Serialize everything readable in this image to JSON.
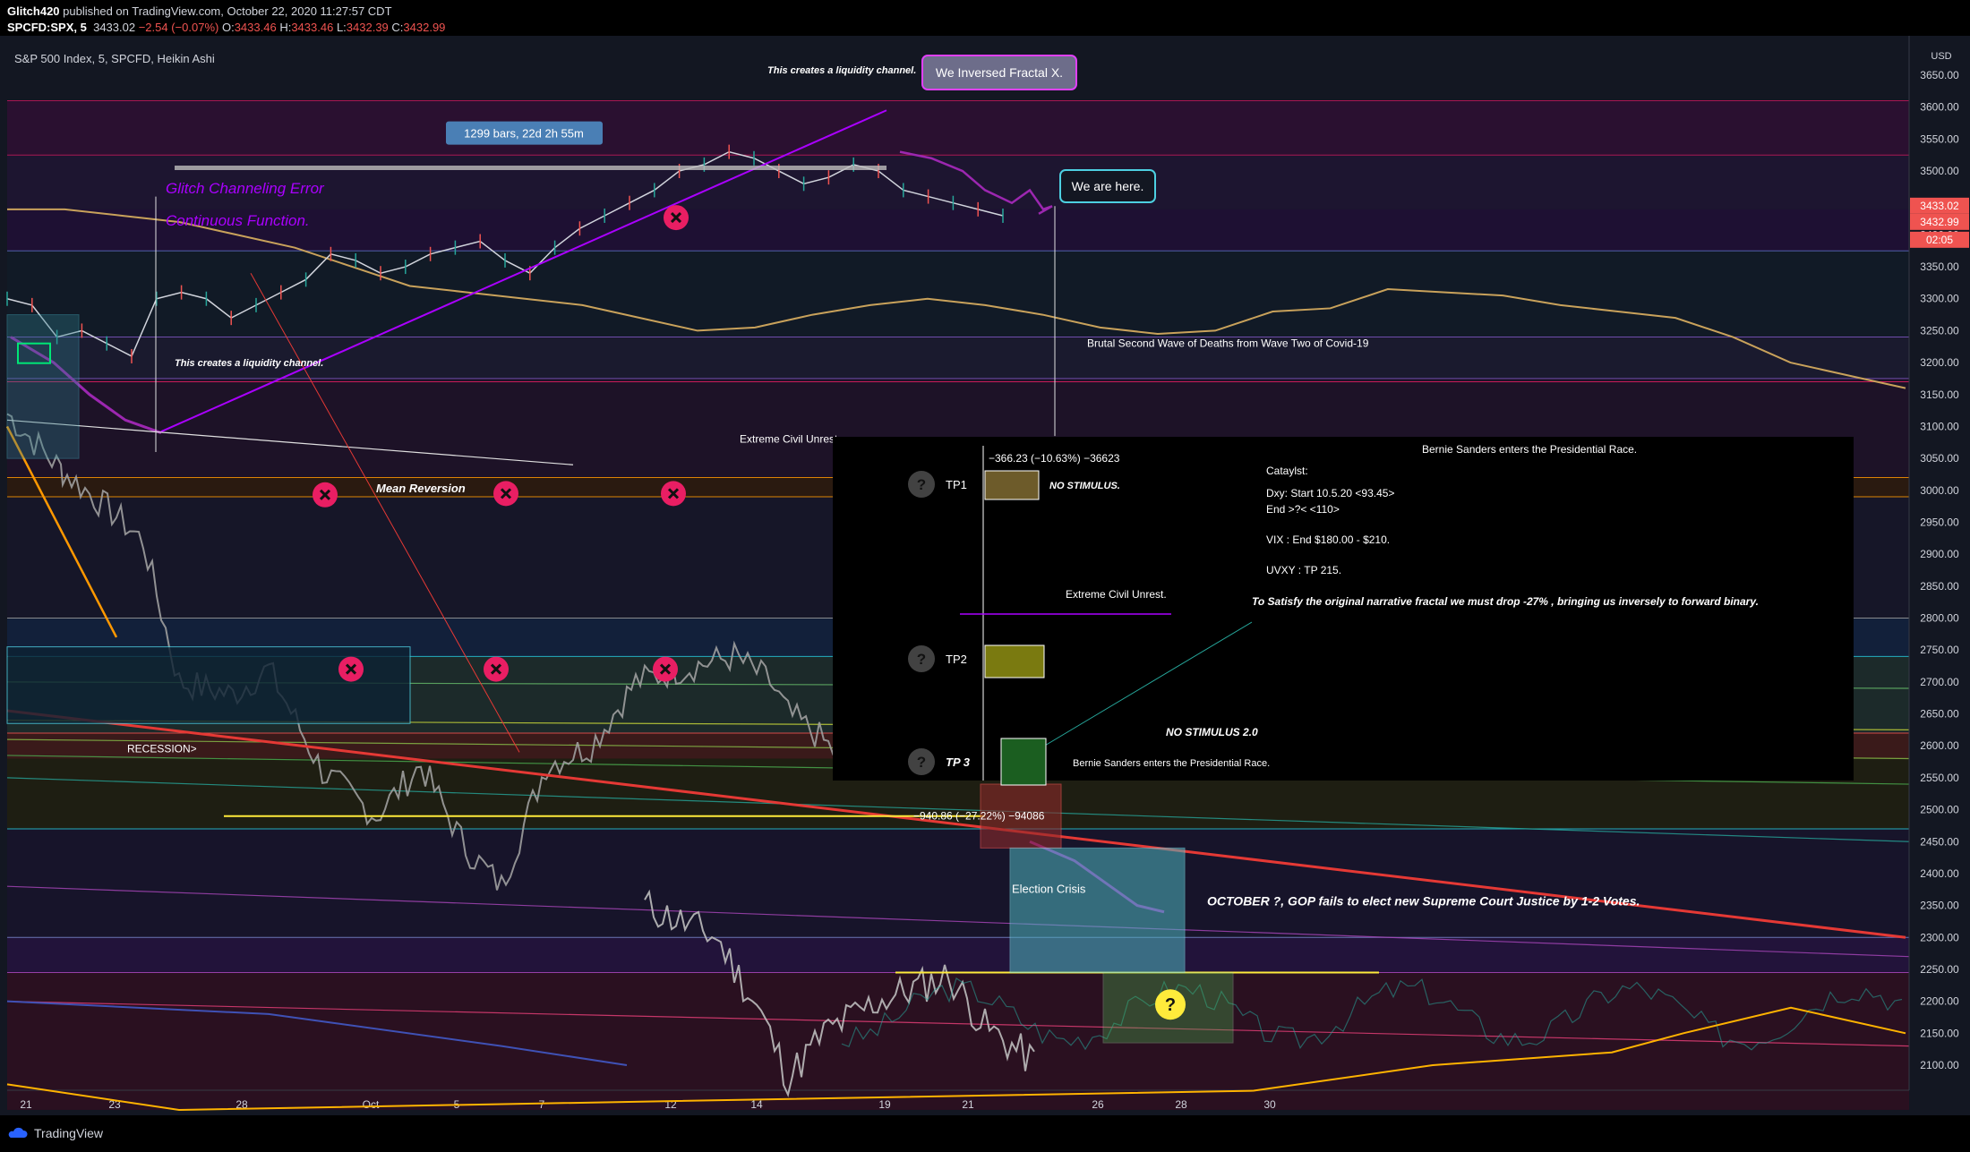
{
  "header": {
    "publisher": "Glitch420",
    "published_text": "published on TradingView.com, October 22, 2020 11:27:57 CDT",
    "symbol": "SPCFD:SPX, 5",
    "last": "3433.02",
    "change": "−2.54 (−0.07%)",
    "o_label": "O:",
    "o": "3433.46",
    "h_label": "H:",
    "h": "3433.46",
    "l_label": "L:",
    "l": "3432.39",
    "c_label": "C:",
    "c": "3432.99"
  },
  "chart_data": {
    "type": "line",
    "title": "S&P 500 Index, 5, SPCFD, Heikin Ashi",
    "currency": "USD",
    "xlabel": "",
    "ylabel": "",
    "ylim": [
      2030,
      3700
    ],
    "x_ticks": [
      "21",
      "23",
      "28",
      "Oct",
      "5",
      "7",
      "12",
      "14",
      "19",
      "21",
      "26",
      "28",
      "30"
    ],
    "y_ticks": [
      3650,
      3600,
      3550,
      3500,
      3450,
      3400,
      3350,
      3300,
      3250,
      3200,
      3150,
      3100,
      3050,
      3000,
      2950,
      2900,
      2850,
      2800,
      2750,
      2700,
      2650,
      2600,
      2550,
      2500,
      2450,
      2400,
      2350,
      2300,
      2250,
      2200,
      2150,
      2100
    ],
    "price_labels": [
      {
        "text": "3433.02",
        "color": "#ef5350"
      },
      {
        "text": "3432.99",
        "color": "#ef5350"
      },
      {
        "text": "02:05",
        "color": "#ef5350"
      }
    ],
    "series": [
      {
        "values": [
          3300,
          3290,
          3240,
          3250,
          3230,
          3210,
          3300,
          3310,
          3300,
          3270,
          3290,
          3310,
          3330,
          3370,
          3360,
          3340,
          3350,
          3370,
          3380,
          3390,
          3360,
          3340,
          3380,
          3410,
          3430,
          3450,
          3470,
          3500,
          3510,
          3530,
          3520,
          3500,
          3480,
          3490,
          3510,
          3500,
          3470,
          3460,
          3450,
          3440,
          3430
        ],
        "color": "#d1d4dc"
      },
      {
        "values": [
          3530,
          3520,
          3500,
          3470,
          3450,
          3470,
          3440,
          3445,
          3433
        ],
        "color": "#9c27b0"
      },
      {
        "values": [
          3440,
          3440,
          3430,
          3420,
          3400,
          3380,
          3350,
          3320,
          3310,
          3300,
          3290,
          3270,
          3250,
          3255,
          3275,
          3290,
          3300,
          3290,
          3275,
          3255,
          3245,
          3250,
          3280,
          3285,
          3315,
          3310,
          3305,
          3290,
          3280,
          3270,
          3240,
          3200,
          3180,
          3160
        ],
        "color": "#c9a25b"
      }
    ],
    "annotations": [
      "1299 bars, 22d 2h 55m",
      "We Inversed Fractal X.",
      "This creates a liquidity channel.",
      "This creates a liquidity channel.",
      "We are here.",
      "Glitch Channeling Error",
      "Continuous Function.",
      "Brutal Second Wave of Deaths from Wave Two of Covid-19",
      "Extreme Civil Unrest.",
      "Mean Reversion",
      "RECESSION>",
      "Election Crisis",
      "OCTOBER ?, GOP fails to elect new Supreme Court Justice by 1-2 Votes.",
      "−940.86 (−27.22%) −94086",
      "Bernie Sanders enters the Presidential Race."
    ],
    "overlay": {
      "measure": "−366.23 (−10.63%) −36623",
      "tp": [
        {
          "label": "TP1",
          "note": "NO STIMULUS."
        },
        {
          "label": "TP2",
          "note": ""
        },
        {
          "label": "TP 3",
          "note": "Bernie Sanders enters the Presidential Race."
        }
      ],
      "bernie_top": "Bernie Sanders enters the Presidential Race.",
      "catalyst_title": "Cataylst:",
      "catalyst_lines": [
        "Dxy: Start 10.5.20 <93.45>",
        "End >?< <110>",
        "VIX : End $180.00 - $210.",
        "UVXY : TP 215."
      ],
      "civil": "Extreme Civil Unrest.",
      "narrative": "To Satisfy the original narrative fractal we must drop -27% , bringing us inversely to forward binary.",
      "stim2": "NO STIMULUS 2.0"
    },
    "grid": false,
    "legend": "none"
  },
  "footer": {
    "brand": "TradingView"
  }
}
